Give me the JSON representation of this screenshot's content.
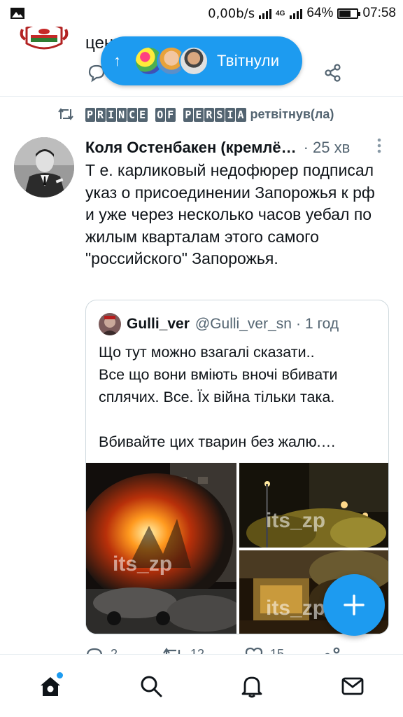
{
  "status_bar": {
    "net_speed": "0,00b/s",
    "network_type": "4G",
    "battery": "64%",
    "battery_level": 0.64,
    "time": "07:58"
  },
  "previous_tweet": {
    "text_fragment": "цент                    2"
  },
  "new_tweets_pill": {
    "label": "Твітнули"
  },
  "retweet": {
    "retweeter_name": "PRINCE OF PERSIA",
    "suffix": "ретвітнув(ла)"
  },
  "tweet": {
    "author_name": "Коля Остенбакен (кремлё…",
    "time": "· 25 хв",
    "body": "Т е. карликовый недофюрер подписал указ о присоединении Запорожья к рф и уже через несколько часов уебал по жилым кварталам этого самого \"российского\" Запорожья.",
    "quote": {
      "name": "Gulli_ver",
      "handle": "@Gulli_ver_sn",
      "time": "1 год",
      "body": "Що тут можно взагалі сказати..\nВсе що вони вміють вночі вбивати сплячих. Все. Їх війна тільки така.\n\nВбивайте цих тварин без жалю.…",
      "watermark": "its_zp"
    },
    "counts": {
      "replies": "2",
      "retweets": "12",
      "likes": "15"
    }
  },
  "colors": {
    "accent": "#1d9bf0",
    "text": "#0f1419",
    "secondary": "#536471",
    "border": "#cfd9de"
  }
}
